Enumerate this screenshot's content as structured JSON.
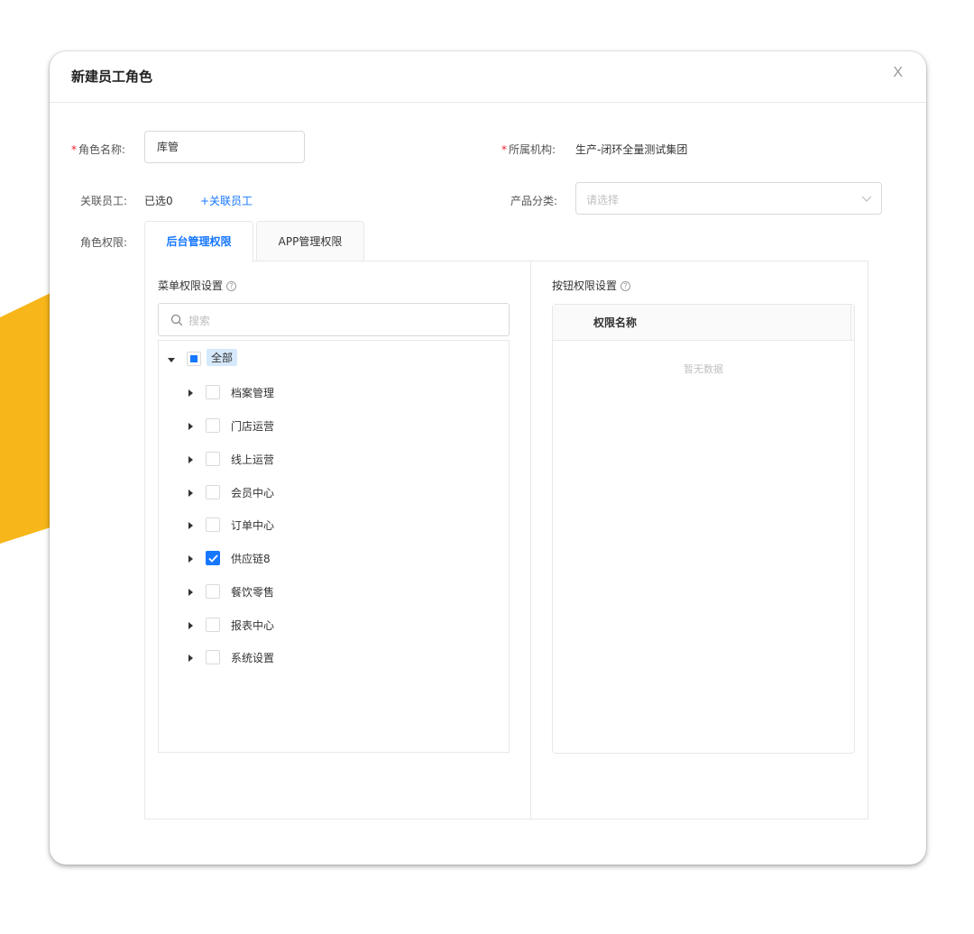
{
  "dialog": {
    "title": "新建员工角色",
    "close_label": "X"
  },
  "form": {
    "role_name": {
      "label": "角色名称:",
      "required_mark": "*",
      "value": "库管"
    },
    "org": {
      "label": "所属机构:",
      "required_mark": "*",
      "value": "生产-闭环全量测试集团"
    },
    "linked_staff": {
      "label": "关联员工:",
      "selected_text": "已选0",
      "add_link": "+关联员工"
    },
    "product_category": {
      "label": "产品分类:",
      "placeholder": "请选择"
    },
    "permissions": {
      "label": "角色权限:"
    }
  },
  "tabs": [
    {
      "label": "后台管理权限",
      "active": true
    },
    {
      "label": "APP管理权限",
      "active": false
    }
  ],
  "menu_permissions": {
    "title": "菜单权限设置",
    "search_placeholder": "搜索",
    "root": {
      "label": "全部",
      "state": "indeterminate"
    },
    "items": [
      {
        "label": "档案管理",
        "checked": false
      },
      {
        "label": "门店运营",
        "checked": false
      },
      {
        "label": "线上运营",
        "checked": false
      },
      {
        "label": "会员中心",
        "checked": false
      },
      {
        "label": "订单中心",
        "checked": false
      },
      {
        "label": "供应链8",
        "checked": true
      },
      {
        "label": "餐饮零售",
        "checked": false
      },
      {
        "label": "报表中心",
        "checked": false
      },
      {
        "label": "系统设置",
        "checked": false
      }
    ]
  },
  "button_permissions": {
    "title": "按钮权限设置",
    "column_header": "权限名称",
    "empty_text": "暂无数据"
  },
  "colors": {
    "accent": "#1677ff",
    "required": "#f5222d",
    "deco_yellow": "#f7b619"
  }
}
